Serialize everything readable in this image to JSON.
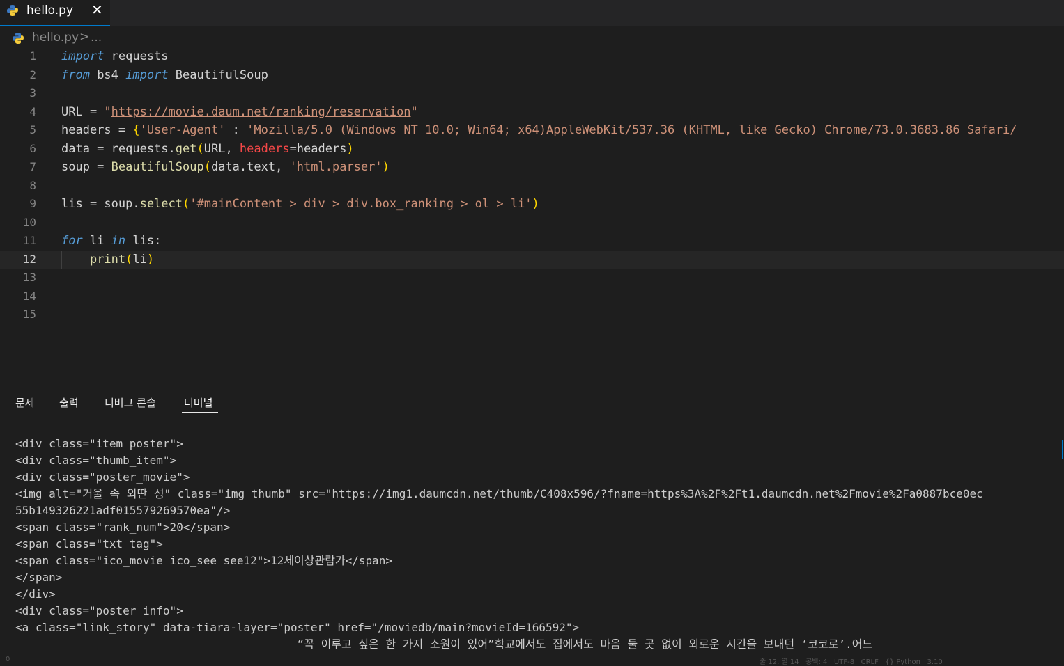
{
  "tab": {
    "filename": "hello.py",
    "close_glyph": "✕"
  },
  "breadcrumb": {
    "file": "hello.py",
    "separator": ">",
    "more": "..."
  },
  "colors": {
    "background": "#1e1e1e",
    "keyword": "#569cd6",
    "string": "#ce9178",
    "function": "#dcdcaa",
    "active_tab_border": "#007acc"
  },
  "editor": {
    "current_line": 12,
    "lines": [
      {
        "n": "1",
        "segments": [
          [
            "kw",
            "import"
          ],
          [
            "op",
            " requests"
          ]
        ]
      },
      {
        "n": "2",
        "segments": [
          [
            "kw",
            "from"
          ],
          [
            "op",
            " bs4 "
          ],
          [
            "kw",
            "import"
          ],
          [
            "op",
            " BeautifulSoup"
          ]
        ]
      },
      {
        "n": "3",
        "segments": []
      },
      {
        "n": "4",
        "segments": [
          [
            "op",
            "URL = "
          ],
          [
            "str",
            "\""
          ],
          [
            "url",
            "https://movie.daum.net/ranking/reservation"
          ],
          [
            "str",
            "\""
          ]
        ]
      },
      {
        "n": "5",
        "segments": [
          [
            "op",
            "headers = "
          ],
          [
            "br1",
            "{"
          ],
          [
            "str",
            "'User-Agent'"
          ],
          [
            "op",
            " : "
          ],
          [
            "str",
            "'Mozilla/5.0 (Windows NT 10.0; Win64; x64)AppleWebKit/537.36 (KHTML, like Gecko) Chrome/73.0.3683.86 Safari/"
          ]
        ]
      },
      {
        "n": "6",
        "segments": [
          [
            "op",
            "data = requests."
          ],
          [
            "fn",
            "get"
          ],
          [
            "br1",
            "("
          ],
          [
            "op",
            "URL, "
          ],
          [
            "param",
            "headers"
          ],
          [
            "op",
            "=headers"
          ],
          [
            "br1",
            ")"
          ]
        ]
      },
      {
        "n": "7",
        "segments": [
          [
            "op",
            "soup = "
          ],
          [
            "fn",
            "BeautifulSoup"
          ],
          [
            "br1",
            "("
          ],
          [
            "op",
            "data.text, "
          ],
          [
            "str",
            "'html.parser'"
          ],
          [
            "br1",
            ")"
          ]
        ]
      },
      {
        "n": "8",
        "segments": []
      },
      {
        "n": "9",
        "segments": [
          [
            "op",
            "lis = soup."
          ],
          [
            "fn",
            "select"
          ],
          [
            "br1",
            "("
          ],
          [
            "str",
            "'#mainContent > div > div.box_ranking > ol > li'"
          ],
          [
            "br1",
            ")"
          ]
        ]
      },
      {
        "n": "10",
        "segments": []
      },
      {
        "n": "11",
        "segments": [
          [
            "kw",
            "for"
          ],
          [
            "op",
            " li "
          ],
          [
            "kw",
            "in"
          ],
          [
            "op",
            " lis:"
          ]
        ]
      },
      {
        "n": "12",
        "segments": [
          [
            "op",
            "    "
          ],
          [
            "fn",
            "print"
          ],
          [
            "br1",
            "("
          ],
          [
            "op",
            "li"
          ],
          [
            "br1",
            ")"
          ]
        ]
      },
      {
        "n": "13",
        "segments": []
      },
      {
        "n": "14",
        "segments": []
      },
      {
        "n": "15",
        "segments": []
      }
    ]
  },
  "panel": {
    "tabs": [
      {
        "label": "문제"
      },
      {
        "label": "출력"
      },
      {
        "label": "디버그 콘솔"
      },
      {
        "label": "터미널",
        "active": true
      }
    ],
    "terminal_lines": [
      "<div class=\"item_poster\">",
      "<div class=\"thumb_item\">",
      "<div class=\"poster_movie\">",
      "<img alt=\"거울 속 외딴 성\" class=\"img_thumb\" src=\"https://img1.daumcdn.net/thumb/C408x596/?fname=https%3A%2F%2Ft1.daumcdn.net%2Fmovie%2Fa0887bce0ec",
      "55b149326221adf015579269570ea\"/>",
      "<span class=\"rank_num\">20</span>",
      "<span class=\"txt_tag\">",
      "<span class=\"ico_movie ico_see see12\">12세이상관람가</span>",
      "</span>",
      "</div>",
      "<div class=\"poster_info\">",
      "<a class=\"link_story\" data-tiara-layer=\"poster\" href=\"/moviedb/main?movieId=166592\">",
      "                                          “꼭 이루고 싶은 한 가지 소원이 있어”학교에서도 집에서도 마음 둘 곳 없이 외로운 시간을 보내던 ‘코코로’.어느"
    ]
  },
  "status": {
    "left": "0",
    "right": "줄 12, 열 14   공백: 4   UTF-8   CRLF   {} Python   3.10"
  }
}
